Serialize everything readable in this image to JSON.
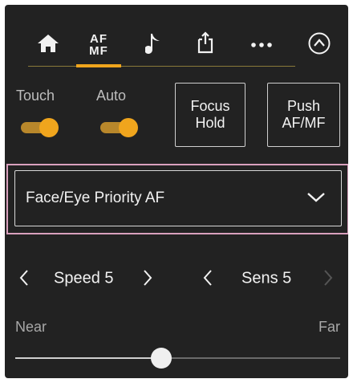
{
  "tabs": [
    {
      "name": "home",
      "icon": "home-icon"
    },
    {
      "name": "af-mf",
      "label_top": "AF",
      "label_bottom": "MF",
      "active": true
    },
    {
      "name": "audio",
      "icon": "music-note-icon"
    },
    {
      "name": "share",
      "icon": "share-icon"
    },
    {
      "name": "more",
      "icon": "more-icon"
    },
    {
      "name": "collapse",
      "icon": "chevron-up-circle-icon"
    }
  ],
  "toggles": {
    "touch": {
      "label": "Touch",
      "on": true
    },
    "auto": {
      "label": "Auto",
      "on": true
    }
  },
  "buttons": {
    "focus_hold": {
      "line1": "Focus",
      "line2": "Hold"
    },
    "push_af_mf": {
      "line1": "Push",
      "line2": "AF/MF"
    }
  },
  "focus_mode": {
    "value": "Face/Eye Priority AF"
  },
  "speed": {
    "label": "Speed 5"
  },
  "sens": {
    "label": "Sens 5"
  },
  "focus_position": {
    "near_label": "Near",
    "far_label": "Far",
    "value": 0.45
  },
  "colors": {
    "accent": "#f0a51d",
    "background": "#222222",
    "selection_highlight": "#d9a0bd"
  }
}
